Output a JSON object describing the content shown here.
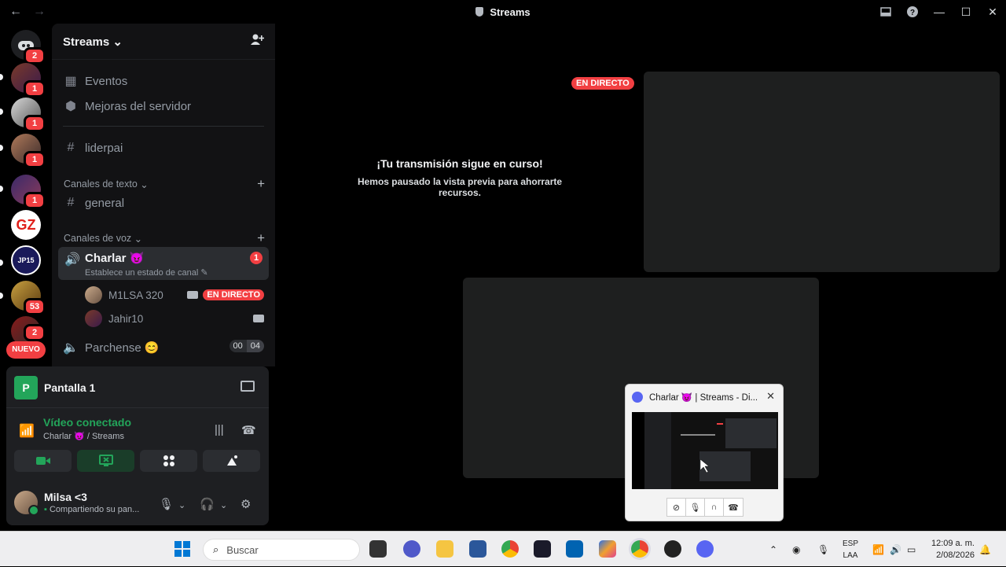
{
  "window": {
    "title": "Streams",
    "back": "←",
    "forward": "→"
  },
  "rail": {
    "badges": [
      "2",
      "1",
      "1",
      "1",
      "1",
      "53",
      "2"
    ],
    "new_label": "NUEVO",
    "gz_label": "GZ",
    "jp_label": "JP15"
  },
  "sidebar": {
    "server_name": "Streams",
    "items": {
      "events": "Eventos",
      "boosts": "Mejoras del servidor",
      "liderpai": "liderpai",
      "text_category": "Canales de texto",
      "general": "general",
      "voice_category": "Canales de voz",
      "charlar": "Charlar",
      "charlar_emoji": "😈",
      "charlar_status": "Establece un estado de canal",
      "charlar_count": "1",
      "user1": "M1LSA 320",
      "user1_live": "EN DIRECTO",
      "user2": "Jahir10",
      "parchense": "Parchense",
      "parchense_emoji": "😊",
      "occ_a": "00",
      "occ_b": "04"
    }
  },
  "panel": {
    "screen_letter": "P",
    "screen_label": "Pantalla 1",
    "video_connected": "Vídeo conectado",
    "channel_path": "Charlar 😈 / Streams",
    "username": "Milsa <3",
    "user_status": "Compartiendo su pan..."
  },
  "stage": {
    "live": "EN DIRECTO",
    "paused_title": "¡Tu transmisión sigue en curso!",
    "paused_sub": "Hemos pausado la vista previa para ahorrarte recursos."
  },
  "thumb": {
    "title": "Charlar 😈 | Streams - Di...",
    "close": "✕"
  },
  "taskbar": {
    "search_placeholder": "Buscar",
    "lang1": "ESP",
    "lang2": "LAA",
    "time": "12:09 a. m.",
    "date": "2/08/2026"
  }
}
